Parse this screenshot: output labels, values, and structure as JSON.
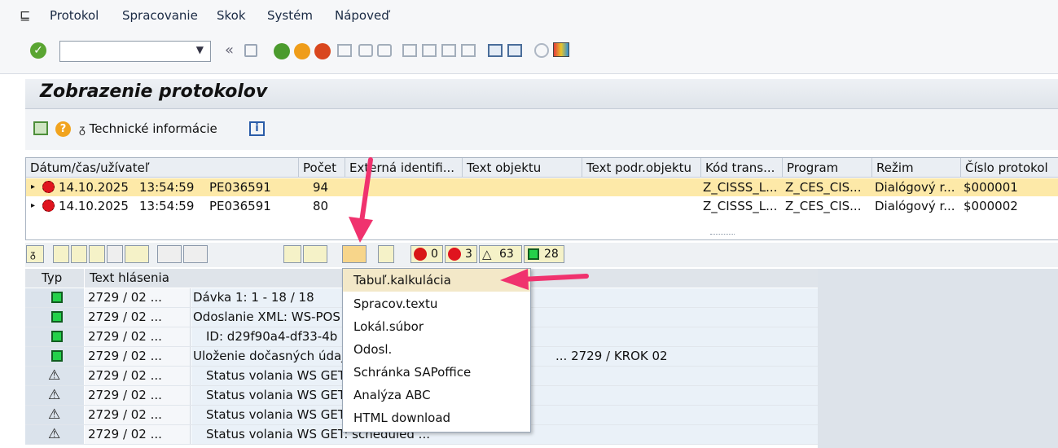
{
  "menu": {
    "items": [
      "Protokol",
      "Spracovanie",
      "Skok",
      "Systém",
      "Nápoveď"
    ]
  },
  "toolbar": {
    "command_value": "",
    "back_label": "«"
  },
  "title": "Zobrazenie protokolov",
  "app_toolbar": {
    "tech_info_label": "Technické informácie"
  },
  "upper_table": {
    "headers": [
      "Dátum/čas/užívateľ",
      "Počet",
      "Externá identifi...",
      "Text objektu",
      "Text podr.objektu",
      "Kód trans...",
      "Program",
      "Režim",
      "Číslo protokol"
    ],
    "rows": [
      {
        "date": "14.10.2025",
        "time": "13:54:59",
        "user": "PE036591",
        "count": "94",
        "code": "Z_CISSS_L...",
        "program": "Z_CES_CIS...",
        "mode": "Dialógový r...",
        "number": "$000001"
      },
      {
        "date": "14.10.2025",
        "time": "13:54:59",
        "user": "PE036591",
        "count": "80",
        "code": "Z_CISSS_L...",
        "program": "Z_CES_CIS...",
        "mode": "Dialógový r...",
        "number": "$000002"
      }
    ]
  },
  "lower_toolbar": {
    "stop_count": "0",
    "error_count": "3",
    "warn_count": "63",
    "ok_count": "28"
  },
  "lower_table": {
    "headers": [
      "Typ",
      "Text hlásenia"
    ],
    "rows": [
      {
        "type": "green",
        "a": "2729 / 02 ...",
        "b": "Dávka 1: 1 - 18 / 18"
      },
      {
        "type": "green",
        "a": "2729 / 02 ...",
        "b": "Odoslanie XML: WS-POS"
      },
      {
        "type": "green",
        "a": "2729 / 02 ...",
        "b": "    ID: d29f90a4-df33-4b"
      },
      {
        "type": "green",
        "a": "2729 / 02 ...",
        "b": "Uloženie dočasných údaj",
        "b2": "... 2729 / KROK 02"
      },
      {
        "type": "warn",
        "a": "2729 / 02 ...",
        "b": "    Status volania WS GET"
      },
      {
        "type": "warn",
        "a": "2729 / 02 ...",
        "b": "    Status volania WS GET"
      },
      {
        "type": "warn",
        "a": "2729 / 02 ...",
        "b": "    Status volania WS GET"
      },
      {
        "type": "warn",
        "a": "2729 / 02 ...",
        "b": "    Status volania WS GET: scheduled ..."
      }
    ]
  },
  "dropdown": {
    "items": [
      "Tabuľ.kalkulácia",
      "Spracov.textu",
      "Lokál.súbor",
      "Odosl.",
      "Schránka SAPoffice",
      "Analýza ABC",
      "HTML download"
    ]
  },
  "colors": {
    "selected_row": "#fde9a8",
    "arrow": "#f0326e"
  }
}
